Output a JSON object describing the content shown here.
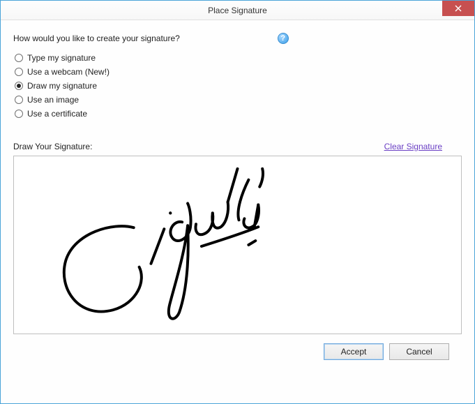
{
  "window": {
    "title": "Place Signature"
  },
  "prompt": "How would you like to create your signature?",
  "help_glyph": "?",
  "options": {
    "type": "Type my signature",
    "webcam": "Use a webcam (New!)",
    "draw": "Draw my signature",
    "image": "Use an image",
    "cert": "Use a certificate",
    "selected": "draw"
  },
  "draw_section": {
    "label": "Draw Your Signature:",
    "clear_link": "Clear Signature"
  },
  "buttons": {
    "accept": "Accept",
    "cancel": "Cancel"
  }
}
